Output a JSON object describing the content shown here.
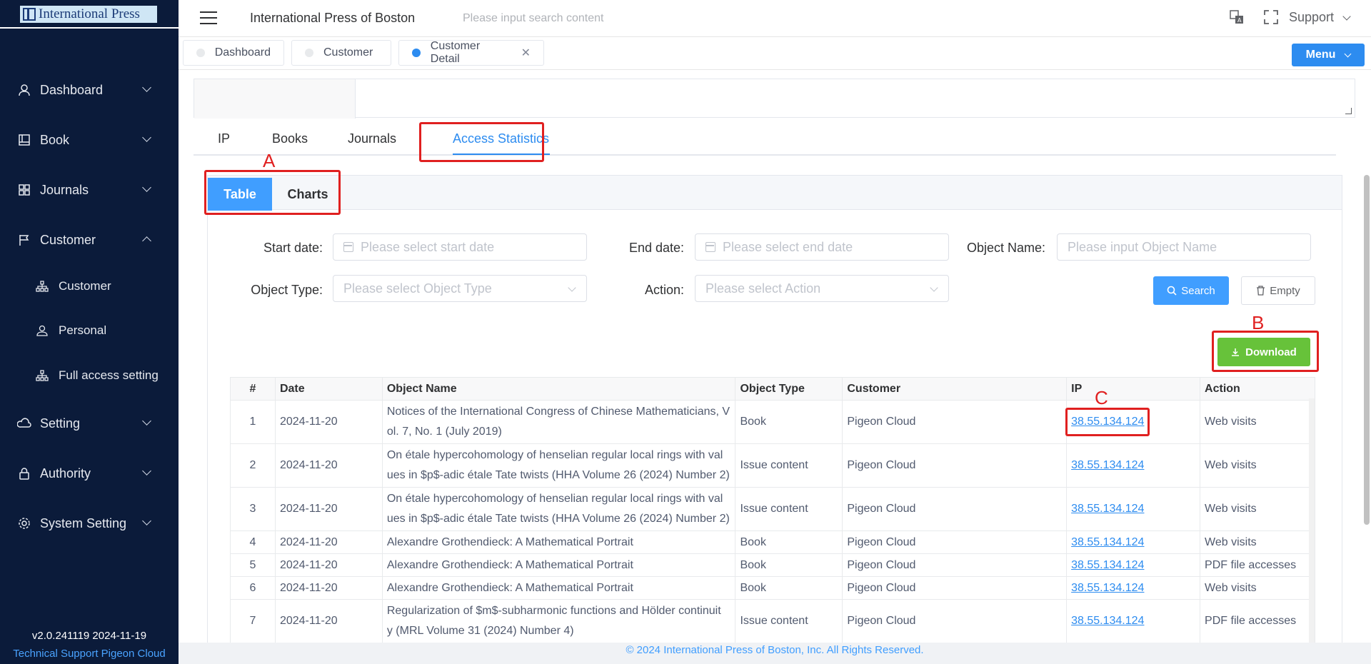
{
  "sidebar": {
    "logo_text": "International Press",
    "nav": [
      {
        "label": "Dashboard"
      },
      {
        "label": "Book"
      },
      {
        "label": "Journals"
      },
      {
        "label": "Customer"
      },
      {
        "label": "Setting"
      },
      {
        "label": "Authority"
      },
      {
        "label": "System Setting"
      }
    ],
    "customer_sub": [
      {
        "label": "Customer"
      },
      {
        "label": "Personal"
      },
      {
        "label": "Full access setting"
      }
    ],
    "version": "v2.0.241119 2024-11-19",
    "support_link": "Technical Support Pigeon Cloud"
  },
  "header": {
    "title": "International Press of Boston",
    "search_placeholder": "Please input search content",
    "support_label": "Support"
  },
  "tags": [
    {
      "label": "Dashboard"
    },
    {
      "label": "Customer"
    },
    {
      "label": "Customer Detail"
    }
  ],
  "menu_button": "Menu",
  "content_tabs": [
    "IP",
    "Books",
    "Journals",
    "Access Statistics"
  ],
  "view_toggle": {
    "table": "Table",
    "charts": "Charts"
  },
  "annotations": {
    "a": "A",
    "b": "B",
    "c": "C"
  },
  "filters": {
    "start_date_label": "Start date:",
    "start_date_placeholder": "Please select  start date",
    "end_date_label": "End date:",
    "end_date_placeholder": "Please select  end date",
    "object_name_label": "Object Name:",
    "object_name_placeholder": "Please input Object Name",
    "object_type_label": "Object Type:",
    "object_type_placeholder": "Please select Object Type",
    "action_label": "Action:",
    "action_placeholder": "Please select Action"
  },
  "buttons": {
    "search": "Search",
    "empty": "Empty",
    "download": "Download"
  },
  "table": {
    "headers": [
      "#",
      "Date",
      "Object Name",
      "Object Type",
      "Customer",
      "IP",
      "Action"
    ],
    "rows": [
      {
        "n": "1",
        "date": "2024-11-20",
        "name1": "Notices of the International Congress of Chinese Mathematicians, V",
        "name2": "ol. 7, No. 1 (July 2019)",
        "type": "Book",
        "customer": "Pigeon Cloud",
        "ip": "38.55.134.124",
        "action": "Web visits"
      },
      {
        "n": "2",
        "date": "2024-11-20",
        "name1": "On étale hypercohomology of henselian regular local rings with val",
        "name2": "ues in $p$-adic étale Tate twists (HHA Volume 26 (2024) Number 2)",
        "type": "Issue content",
        "customer": "Pigeon Cloud",
        "ip": "38.55.134.124",
        "action": "Web visits"
      },
      {
        "n": "3",
        "date": "2024-11-20",
        "name1": "On étale hypercohomology of henselian regular local rings with val",
        "name2": "ues in $p$-adic étale Tate twists (HHA Volume 26 (2024) Number 2)",
        "type": "Issue content",
        "customer": "Pigeon Cloud",
        "ip": "38.55.134.124",
        "action": "Web visits"
      },
      {
        "n": "4",
        "date": "2024-11-20",
        "name1": "Alexandre Grothendieck: A Mathematical Portrait",
        "name2": "",
        "type": "Book",
        "customer": "Pigeon Cloud",
        "ip": "38.55.134.124",
        "action": "Web visits"
      },
      {
        "n": "5",
        "date": "2024-11-20",
        "name1": "Alexandre Grothendieck: A Mathematical Portrait",
        "name2": "",
        "type": "Book",
        "customer": "Pigeon Cloud",
        "ip": "38.55.134.124",
        "action": "PDF file accesses"
      },
      {
        "n": "6",
        "date": "2024-11-20",
        "name1": "Alexandre Grothendieck: A Mathematical Portrait",
        "name2": "",
        "type": "Book",
        "customer": "Pigeon Cloud",
        "ip": "38.55.134.124",
        "action": "Web visits"
      },
      {
        "n": "7",
        "date": "2024-11-20",
        "name1": "Regularization of $m$-subharmonic functions and Hölder continuit",
        "name2": "y (MRL Volume 31 (2024) Number 4)",
        "type": "Issue content",
        "customer": "Pigeon Cloud",
        "ip": "38.55.134.124",
        "action": "PDF file accesses"
      }
    ]
  },
  "footer": "© 2024 International Press of Boston, Inc. All Rights Reserved.",
  "colors": {
    "sidebar_bg": "#0b1b3a",
    "primary": "#409eff",
    "download": "#67c23a",
    "annotation": "#e02020"
  }
}
